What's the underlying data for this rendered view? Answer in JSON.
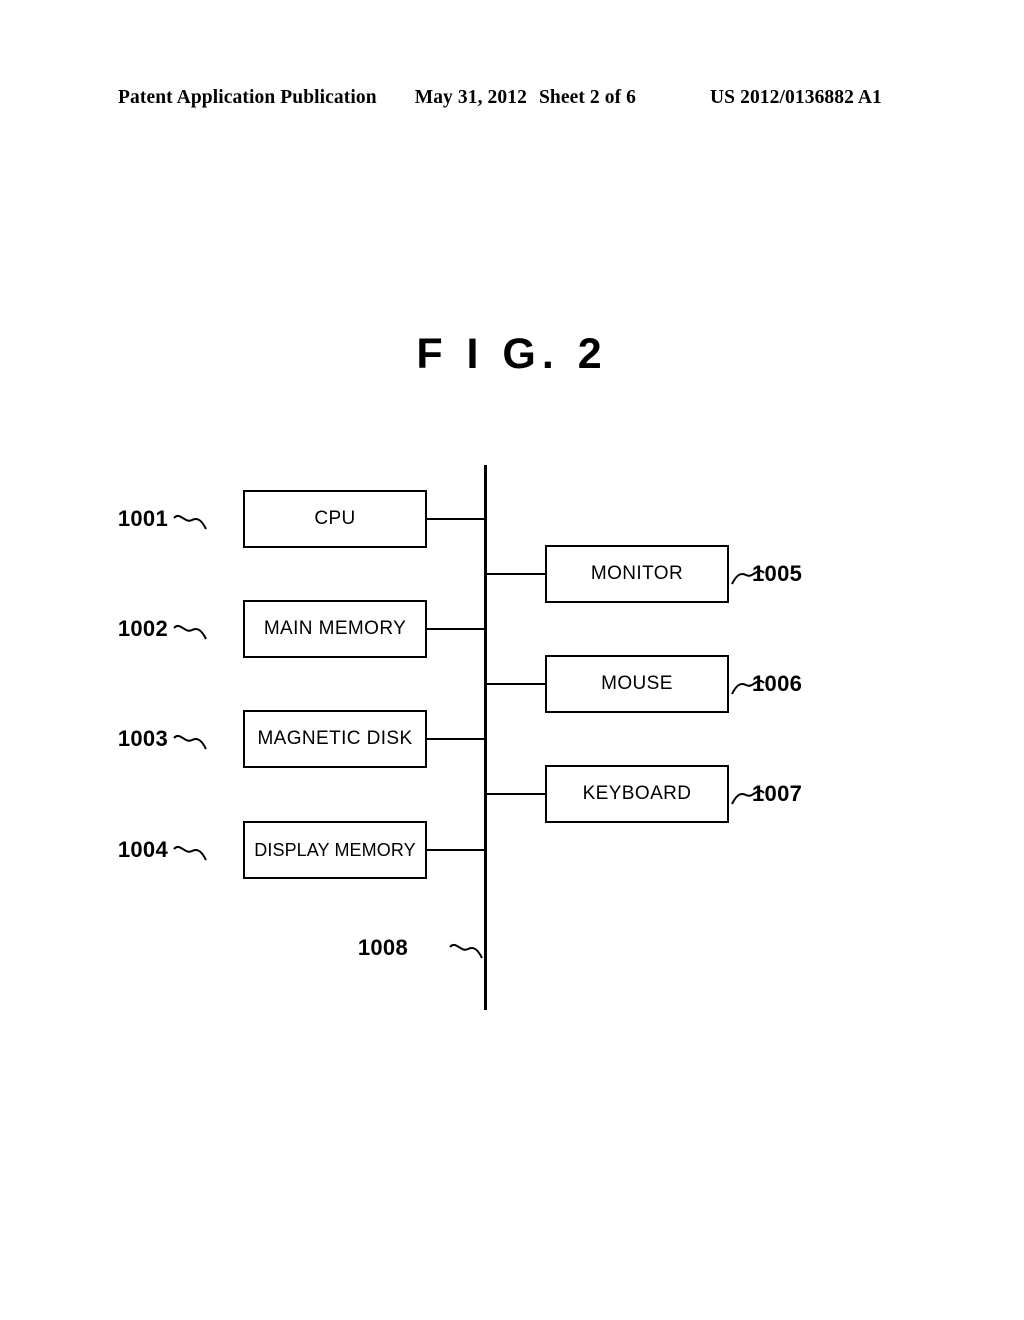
{
  "header": {
    "publication": "Patent Application Publication",
    "date": "May 31, 2012",
    "sheet": "Sheet 2 of 6",
    "patent_number": "US 2012/0136882 A1"
  },
  "figure": {
    "title": "F I G.  2",
    "colors": {
      "ink": "#000000",
      "background": "#ffffff"
    },
    "blocks": {
      "cpu": {
        "label": "CPU",
        "ref": "1001"
      },
      "main_memory": {
        "label": "MAIN MEMORY",
        "ref": "1002"
      },
      "magnetic_disk": {
        "label": "MAGNETIC DISK",
        "ref": "1003"
      },
      "display_memory": {
        "label": "DISPLAY MEMORY",
        "ref": "1004"
      },
      "monitor": {
        "label": "MONITOR",
        "ref": "1005"
      },
      "mouse": {
        "label": "MOUSE",
        "ref": "1006"
      },
      "keyboard": {
        "label": "KEYBOARD",
        "ref": "1007"
      },
      "bus": {
        "label": "",
        "ref": "1008"
      }
    }
  }
}
